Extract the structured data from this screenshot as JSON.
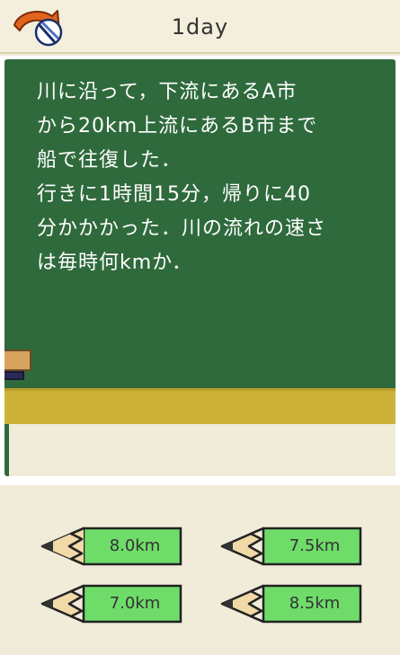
{
  "header": {
    "title": "1day",
    "back_icon": "curved-arrow-back-icon"
  },
  "question": {
    "text": "川に沿って，下流にあるA市\nから20km上流にあるB市まで\n船で往復した．\n行きに1時間15分，帰りに40\n分かかかった．川の流れの速さ\nは毎時何kmか．"
  },
  "answers": [
    {
      "label": "8.0km"
    },
    {
      "label": "7.5km"
    },
    {
      "label": "7.0km"
    },
    {
      "label": "8.5km"
    }
  ],
  "colors": {
    "chalkboard": "#2f6a3c",
    "chalk_tray": "#cdb23a",
    "pencil_body": "#6fdc6a",
    "background": "#f0ecd9"
  }
}
